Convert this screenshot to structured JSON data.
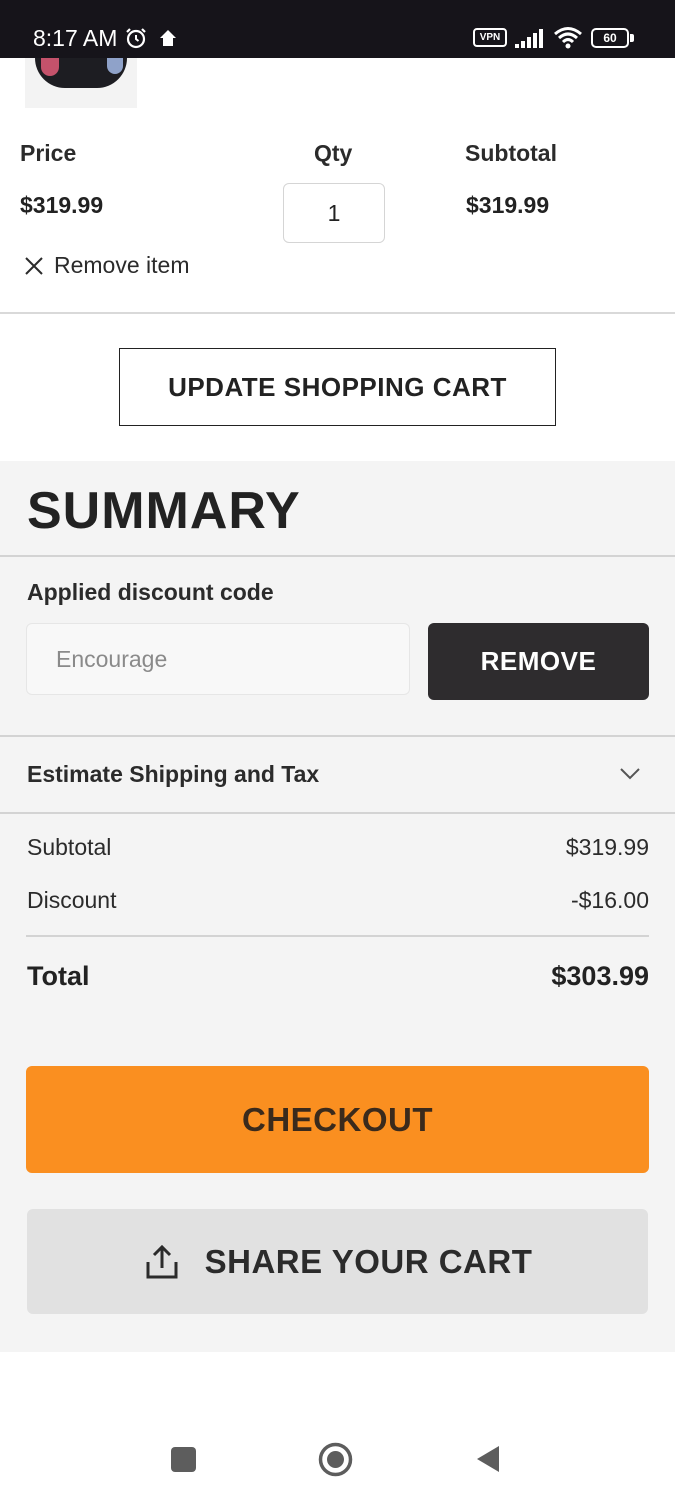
{
  "status_bar": {
    "time": "8:17 AM",
    "vpn_label": "VPN",
    "battery_level": "60",
    "icons": [
      "alarm-icon",
      "home-icon",
      "signal-icon",
      "wifi-icon",
      "battery-icon"
    ]
  },
  "cart_item": {
    "price_label": "Price",
    "qty_label": "Qty",
    "subtotal_label": "Subtotal",
    "price": "$319.99",
    "qty": "1",
    "subtotal": "$319.99",
    "remove_label": "Remove item"
  },
  "update_cart_label": "UPDATE SHOPPING CART",
  "summary": {
    "title": "SUMMARY",
    "discount_label": "Applied discount code",
    "discount_placeholder": "Encourage",
    "remove_button": "REMOVE",
    "shipping_label": "Estimate Shipping and Tax",
    "subtotal_label": "Subtotal",
    "subtotal_value": "$319.99",
    "discount_row_label": "Discount",
    "discount_value": "-$16.00",
    "total_label": "Total",
    "total_value": "$303.99",
    "checkout_label": "CHECKOUT",
    "share_label": "SHARE YOUR CART"
  },
  "colors": {
    "checkout": "#fa8f20",
    "remove_button": "#2e2c2e",
    "summary_background": "#f4f4f4",
    "status_bar": "#16141a"
  }
}
